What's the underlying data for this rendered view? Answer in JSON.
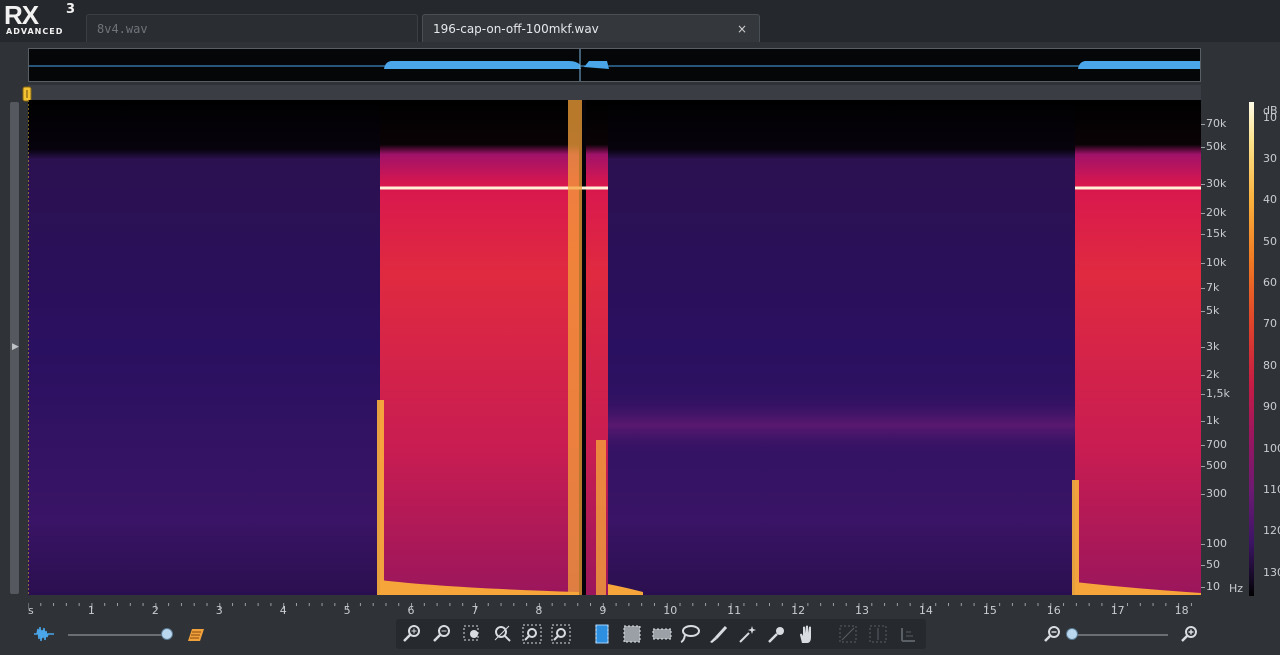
{
  "app": {
    "logo_text": "RX",
    "logo_version": "3",
    "logo_edition": "ADVANCED"
  },
  "tabs": [
    {
      "label": "8v4.wav",
      "active": false
    },
    {
      "label": "196-cap-on-off-100mkf.wav",
      "active": true
    }
  ],
  "tab_close_glyph": "×",
  "frequency_axis": {
    "unit": "Hz",
    "labels": [
      "70k",
      "50k",
      "30k",
      "20k",
      "15k",
      "10k",
      "7k",
      "5k",
      "3k",
      "2k",
      "1,5k",
      "1k",
      "700",
      "500",
      "300",
      "100",
      "50",
      "10"
    ]
  },
  "db_scale": {
    "unit": "dB",
    "labels": [
      "10",
      "30",
      "40",
      "50",
      "60",
      "70",
      "80",
      "90",
      "100",
      "110",
      "120",
      "130"
    ]
  },
  "time_axis": {
    "unit": "s",
    "labels": [
      "1",
      "2",
      "3",
      "4",
      "5",
      "6",
      "7",
      "8",
      "9",
      "10",
      "11",
      "12",
      "13",
      "14",
      "15",
      "16",
      "17",
      "18"
    ]
  },
  "colors": {
    "background": "#2f3237",
    "waveform": "#4aa6e8",
    "spectro_hot": "#e0432a",
    "spectro_cool": "#3d1466"
  },
  "toolbar": {
    "left_icons": [
      "waveform-display-icon",
      "spectrogram-display-icon"
    ],
    "center_icons": [
      "zoom-in-icon",
      "zoom-out-icon",
      "zoom-selection-icon",
      "zoom-reset-icon",
      "zoom-time-in-icon",
      "zoom-time-out-icon",
      "time-selection-icon",
      "rectangle-selection-icon",
      "frequency-selection-icon",
      "lasso-icon",
      "brush-icon",
      "magic-wand-icon",
      "harmonic-wand-icon",
      "hand-icon",
      "disabled-tool-1-icon",
      "disabled-tool-2-icon",
      "disabled-tool-3-icon"
    ],
    "right_icons": [
      "zoom-out-icon",
      "zoom-in-icon"
    ]
  }
}
